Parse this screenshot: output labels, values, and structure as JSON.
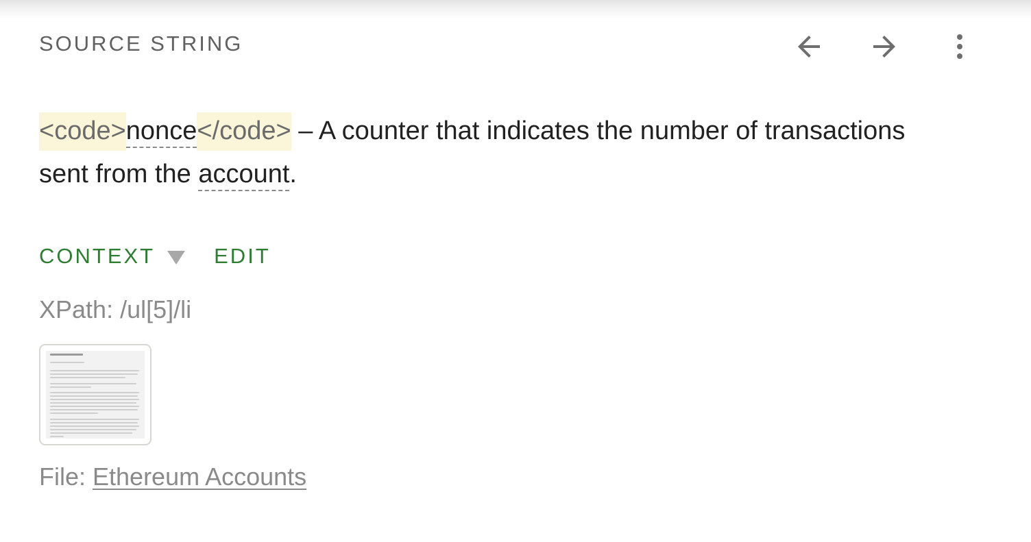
{
  "header": {
    "title": "SOURCE STRING",
    "icons": {
      "previous": "arrow-left-icon",
      "next": "arrow-right-icon",
      "more": "more-vertical-icon"
    }
  },
  "source": {
    "tag_open": "<code>",
    "term_nonce": "nonce",
    "tag_close": "</code>",
    "text_after_code": " – A counter that indicates the number of transactions sent from the ",
    "term_account": "account",
    "text_end": "."
  },
  "context": {
    "tab_context_label": "CONTEXT",
    "tab_edit_label": "EDIT",
    "xpath": "XPath: /ul[5]/li",
    "file_label": "File: ",
    "file_link": "Ethereum Accounts"
  },
  "colors": {
    "accent_green": "#2e7d32",
    "tag_highlight": "#fbf6d9",
    "muted_text": "#8a8a8a",
    "primary_text": "#212121"
  }
}
